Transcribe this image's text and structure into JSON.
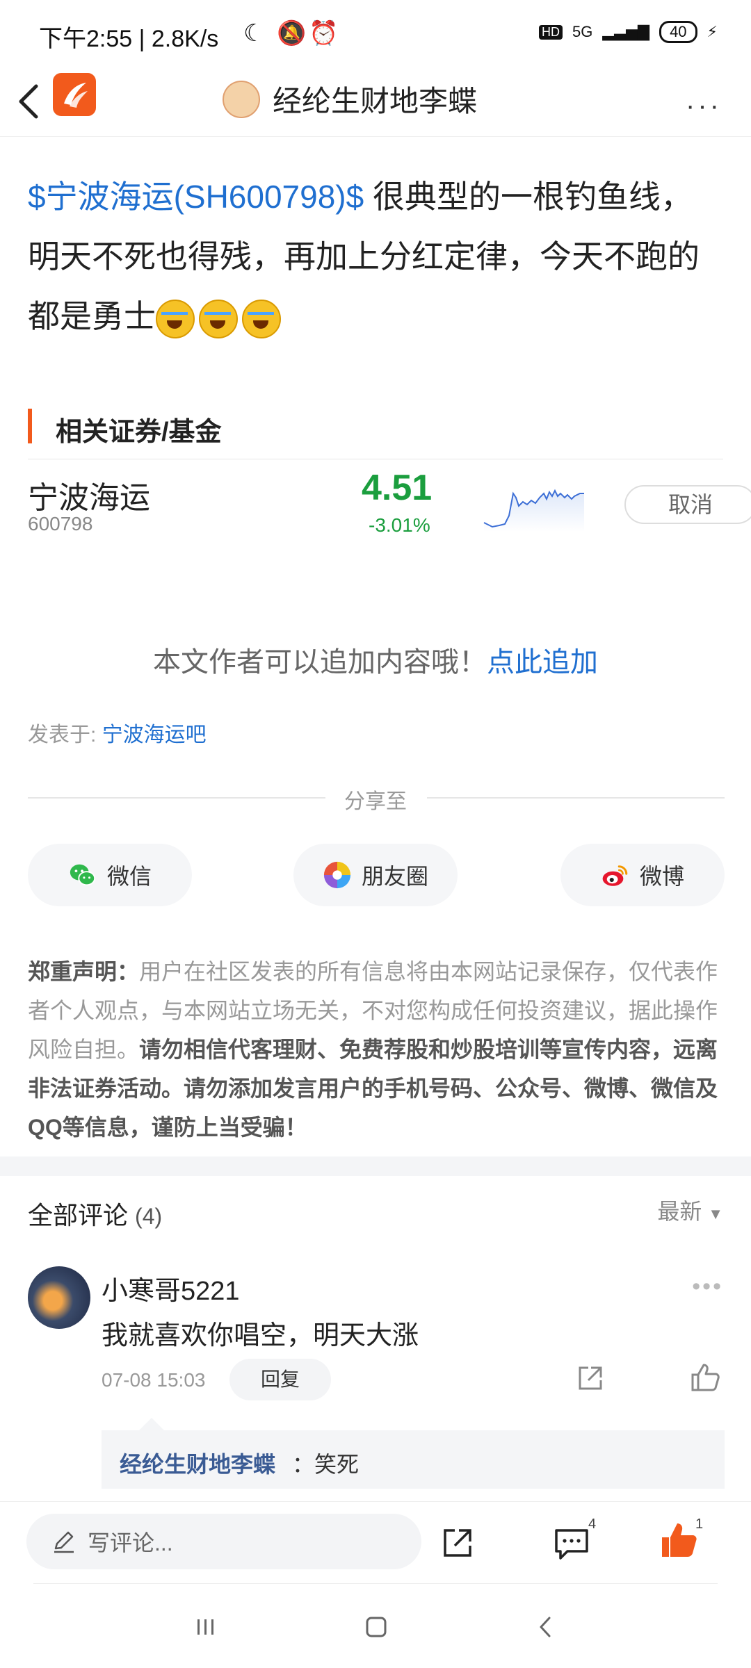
{
  "status_bar": {
    "left_text": "下午2:55 | 2.8K/s",
    "network": "5G",
    "battery": "40"
  },
  "header": {
    "title": "经纶生财地李蝶",
    "more_label": "···"
  },
  "post": {
    "stock_tag": "$宁波海运(SH600798)$",
    "text": "很典型的一根钓鱼线，明天不死也得残，再加上分红定律，今天不跑的都是勇士"
  },
  "related": {
    "title": "相关证券/基金",
    "stock": {
      "name": "宁波海运",
      "code": "600798",
      "price": "4.51",
      "change": "-3.01%",
      "action": "取消"
    }
  },
  "append": {
    "text": "本文作者可以追加内容哦！",
    "link": "点此追加"
  },
  "posted_in": {
    "label": "发表于:",
    "forum": "宁波海运吧"
  },
  "share": {
    "label": "分享至",
    "buttons": [
      {
        "label": "微信",
        "icon": "wechat-icon"
      },
      {
        "label": "朋友圈",
        "icon": "moments-icon"
      },
      {
        "label": "微博",
        "icon": "weibo-icon"
      }
    ]
  },
  "disclaimer": {
    "title": "郑重声明：",
    "normal": "用户在社区发表的所有信息将由本网站记录保存，仅代表作者个人观点，与本网站立场无关，不对您构成任何投资建议，据此操作风险自担。",
    "bold": "请勿相信代客理财、免费荐股和炒股培训等宣传内容，远离非法证券活动。请勿添加发言用户的手机号码、公众号、微博、微信及QQ等信息，谨防上当受骗！"
  },
  "comments": {
    "title": "全部评论",
    "count": "(4)",
    "sort": "最新",
    "items": [
      {
        "user": "小寒哥5221",
        "text": "我就喜欢你唱空，明天大涨",
        "time": "07-08 15:03",
        "reply_label": "回复",
        "sub_reply": {
          "user": "经纶生财地李蝶",
          "text": "：笑死"
        }
      }
    ]
  },
  "bottom_bar": {
    "placeholder": "写评论...",
    "comment_count": "4",
    "like_count": "1"
  },
  "colors": {
    "accent": "#f25a1c",
    "link": "#1f6fd0",
    "down_green": "#1b9e3e"
  }
}
